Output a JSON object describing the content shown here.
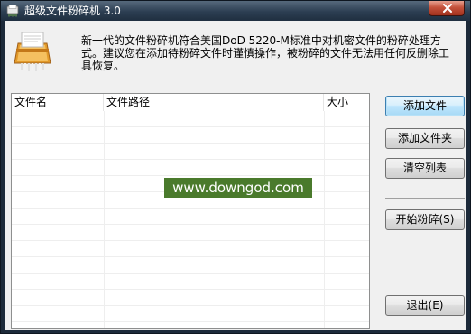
{
  "window": {
    "title": "超级文件粉碎机  3.0"
  },
  "description": "新一代的文件粉碎机符合美国DoD 5220-M标准中对机密文件的粉碎处理方式。建议您在添加待粉碎文件时谨慎操作，被粉碎的文件无法用任何反删除工具恢复。",
  "file_list": {
    "columns": [
      "文件名",
      "文件路径",
      "大小"
    ],
    "rows": []
  },
  "watermark": "www.downgod.com",
  "buttons": {
    "add_file": "添加文件",
    "add_folder": "添加文件夹",
    "clear_list": "清空列表",
    "start_shred": "开始粉碎(S)",
    "exit": "退出(E)"
  },
  "colors": {
    "titlebar": "#2c3e52",
    "client_bg": "#f0f0f0",
    "close_button": "#c5523c",
    "focused_button": "#bee6fd",
    "watermark_bg": "#4a7a2c"
  },
  "icons": {
    "title_icon": "app-shredder-icon",
    "close": "close-icon",
    "logo": "shredder-logo-icon"
  }
}
